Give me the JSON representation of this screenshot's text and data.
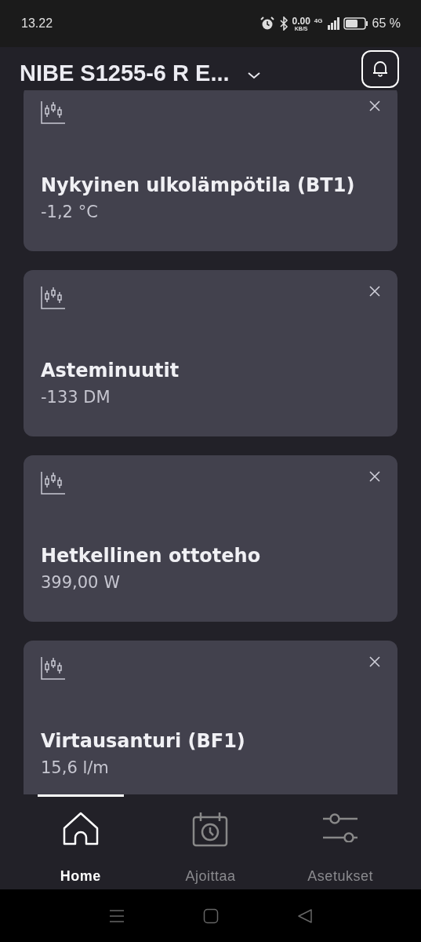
{
  "status_bar": {
    "time": "13.22",
    "speed": "0.00",
    "speed_unit": "KB/S",
    "network": "4G",
    "battery": "65 %"
  },
  "header": {
    "title": "NIBE S1255-6 R E..."
  },
  "cards": [
    {
      "title": "Nykyinen ulkolämpötila (BT1)",
      "value": "-1,2 °C"
    },
    {
      "title": "Asteminuutit",
      "value": "-133 DM"
    },
    {
      "title": "Hetkellinen ottoteho",
      "value": "399,00 W"
    },
    {
      "title": "Virtausanturi (BF1)",
      "value": "15,6 l/m"
    }
  ],
  "tabs": [
    {
      "label": "Home",
      "kind": "home",
      "selected": true
    },
    {
      "label": "Ajoittaa",
      "kind": "schedule",
      "selected": false
    },
    {
      "label": "Asetukset",
      "kind": "settings",
      "selected": false
    }
  ]
}
